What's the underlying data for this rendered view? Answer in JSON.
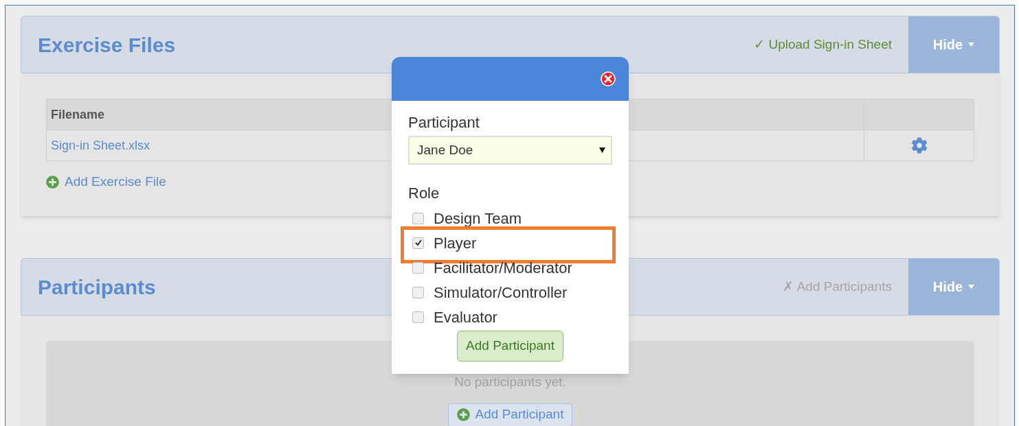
{
  "sections": [
    {
      "title": "Exercise Files",
      "action": {
        "label": "✓ Upload Sign-in Sheet",
        "done": true
      },
      "toggle": "Hide",
      "table": {
        "columns": [
          "Filename"
        ],
        "rows": [
          {
            "filename": "Sign-in Sheet.xlsx"
          }
        ]
      },
      "add_link": "Add Exercise File"
    },
    {
      "title": "Participants",
      "action": {
        "label": "✗ Add Participants",
        "done": false
      },
      "toggle": "Hide",
      "empty_text": "No participants yet.",
      "add_button": "Add Participant"
    }
  ],
  "modal": {
    "participant_label": "Participant",
    "participant_value": "Jane Doe",
    "role_label": "Role",
    "roles": [
      {
        "label": "Design Team",
        "checked": false,
        "highlighted": false
      },
      {
        "label": "Player",
        "checked": true,
        "highlighted": true
      },
      {
        "label": "Facilitator/Moderator",
        "checked": false,
        "highlighted": false
      },
      {
        "label": "Simulator/Controller",
        "checked": false,
        "highlighted": false
      },
      {
        "label": "Evaluator",
        "checked": false,
        "highlighted": false
      }
    ],
    "submit": "Add Participant"
  }
}
